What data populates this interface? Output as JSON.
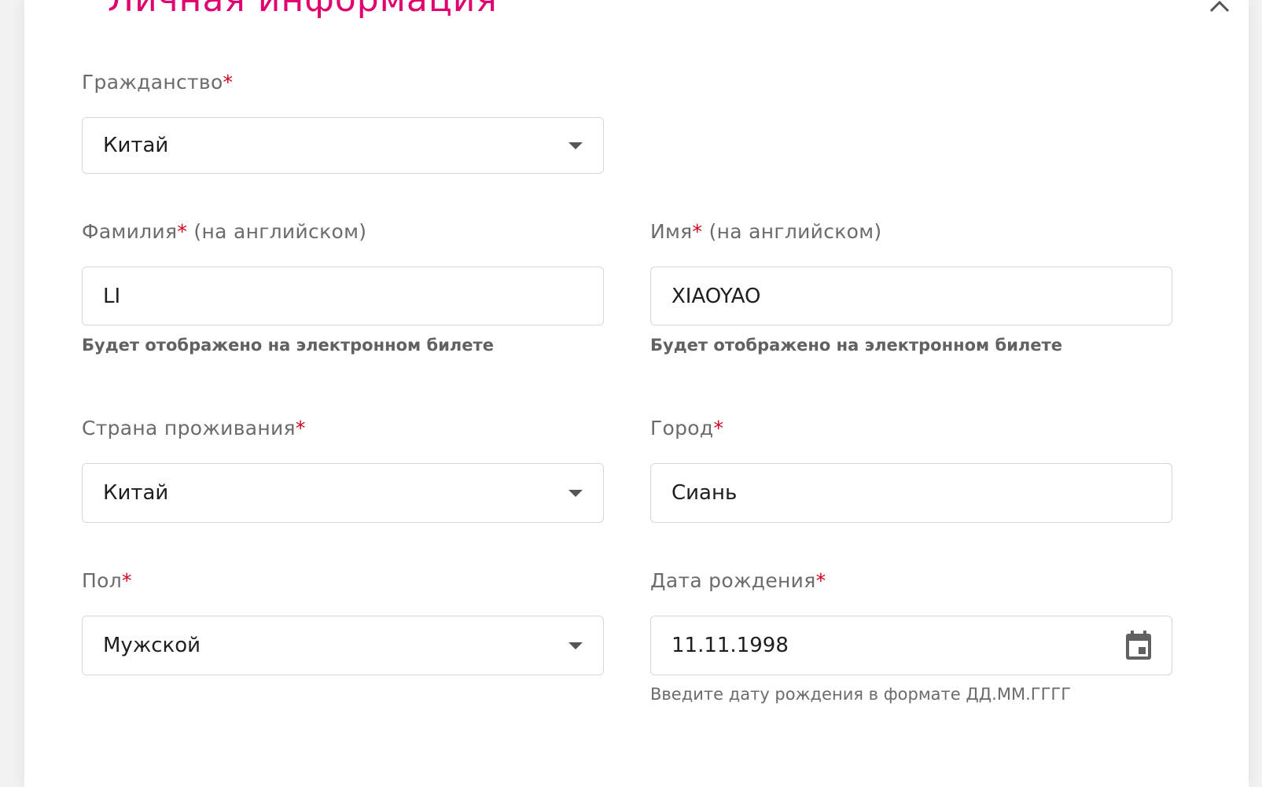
{
  "section": {
    "title": "Личная информация",
    "collapse_icon": "chevron-up-icon"
  },
  "required_mark": "*",
  "citizenship": {
    "label": "Гражданство",
    "value": "Китай"
  },
  "last_name": {
    "label": "Фамилия",
    "label_suffix": " (на английском)",
    "value": "LI",
    "hint": "Будет отображено на электронном билете"
  },
  "first_name": {
    "label": "Имя",
    "label_suffix": " (на английском)",
    "value": "XIAOYAO",
    "hint": "Будет отображено на электронном билете"
  },
  "country": {
    "label": "Страна проживания",
    "value": "Китай"
  },
  "city": {
    "label": "Город",
    "value": "Сиань"
  },
  "gender": {
    "label": "Пол",
    "value": "Мужской"
  },
  "birth_date": {
    "label": "Дата рождения",
    "value": "11.11.1998",
    "icon": "calendar-icon",
    "hint": "Введите дату рождения в формате ДД.ММ.ГГГГ"
  },
  "colors": {
    "accent": "#e0006e",
    "required": "#d0021b",
    "border": "#d6d6d6"
  }
}
